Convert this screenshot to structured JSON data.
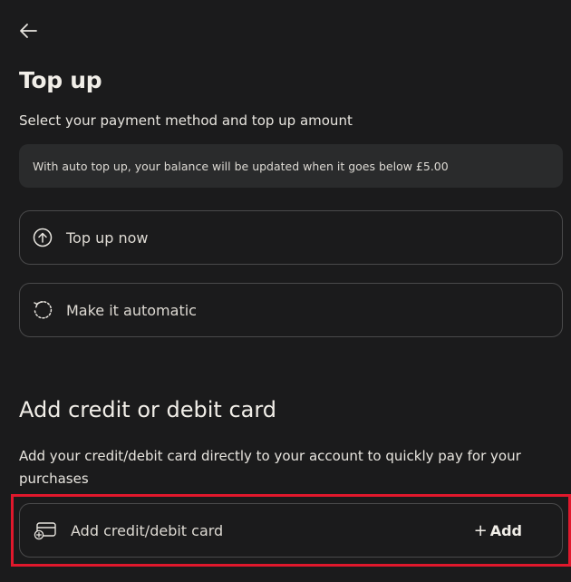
{
  "header": {
    "back_icon": "arrow-left-icon"
  },
  "top_up": {
    "title": "Top up",
    "subtitle": "Select your payment method and top up amount",
    "info": "With auto top up, your balance will be updated when it goes below £5.00",
    "options": [
      {
        "label": "Top up now",
        "icon": "arrow-up-circle-icon"
      },
      {
        "label": "Make it automatic",
        "icon": "refresh-icon"
      }
    ]
  },
  "card_section": {
    "title": "Add credit or debit card",
    "description": "Add your credit/debit card directly to your account to quickly pay for your purchases",
    "row_label": "Add credit/debit card",
    "row_icon": "credit-card-add-icon",
    "add_plus": "+",
    "add_label": "Add"
  },
  "colors": {
    "background": "#1b1b1c",
    "info_box": "#2a2b2c",
    "border": "#4a4a4b",
    "highlight": "#e0182c"
  }
}
